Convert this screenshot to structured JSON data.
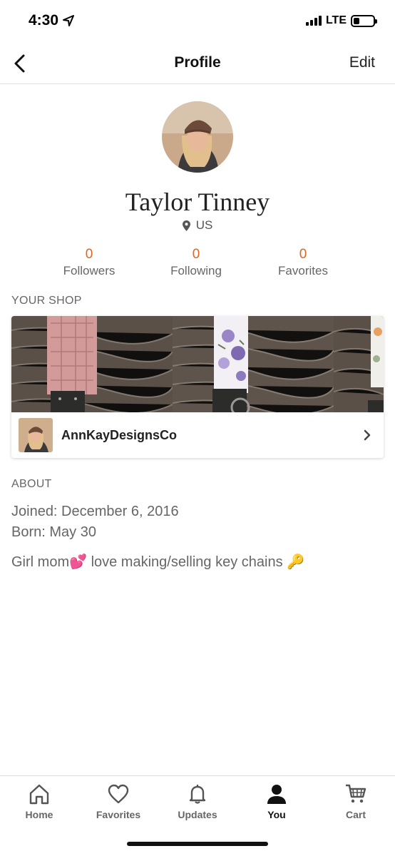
{
  "status_bar": {
    "time": "4:30",
    "network": "LTE",
    "battery_level": 0.3
  },
  "header": {
    "title": "Profile",
    "edit_label": "Edit"
  },
  "profile": {
    "name": "Taylor Tinney",
    "location": "US",
    "stats": [
      {
        "value": "0",
        "label": "Followers"
      },
      {
        "value": "0",
        "label": "Following"
      },
      {
        "value": "0",
        "label": "Favorites"
      }
    ]
  },
  "shop": {
    "section_label": "YOUR SHOP",
    "name": "AnnKayDesignsCo"
  },
  "about": {
    "section_label": "ABOUT",
    "joined": "Joined: December 6, 2016",
    "born": "Born: May 30",
    "bio": "Girl mom💕 love making/selling key chains 🔑"
  },
  "tabs": [
    {
      "label": "Home",
      "icon": "home-icon"
    },
    {
      "label": "Favorites",
      "icon": "heart-icon"
    },
    {
      "label": "Updates",
      "icon": "bell-icon"
    },
    {
      "label": "You",
      "icon": "person-icon",
      "active": true
    },
    {
      "label": "Cart",
      "icon": "cart-icon"
    }
  ],
  "colors": {
    "accent": "#e0641e",
    "text": "#222222",
    "muted": "#666666"
  }
}
